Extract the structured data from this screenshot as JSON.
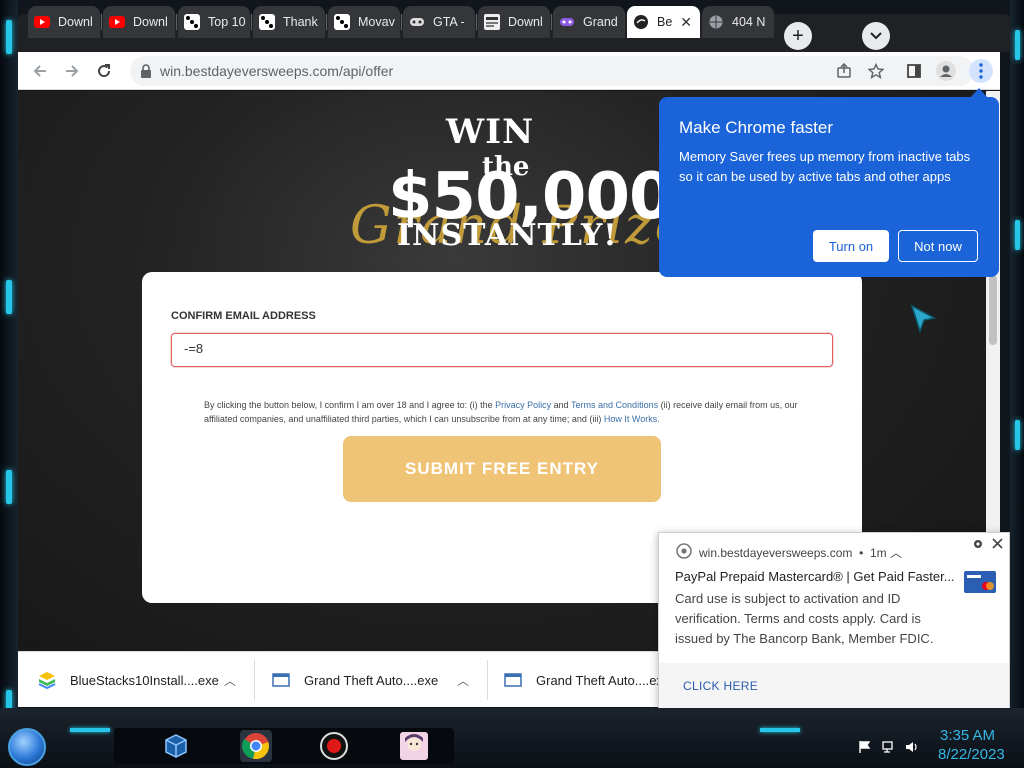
{
  "browser": {
    "tabs": [
      {
        "label": "Downl",
        "favicon": "youtube-icon"
      },
      {
        "label": "Downl",
        "favicon": "youtube-icon"
      },
      {
        "label": "Top 10",
        "favicon": "dice-icon"
      },
      {
        "label": "Thank",
        "favicon": "dice-icon"
      },
      {
        "label": "Movav",
        "favicon": "dice-icon"
      },
      {
        "label": "GTA -",
        "favicon": "gamepad-icon"
      },
      {
        "label": "Downl",
        "favicon": "download-site-icon"
      },
      {
        "label": "Grand",
        "favicon": "purple-gamepad-icon"
      },
      {
        "label": "Be",
        "favicon": "site-icon",
        "active": true
      },
      {
        "label": "404 N",
        "favicon": "globe-icon"
      }
    ],
    "address": "win.bestdayeversweeps.com/api/offer"
  },
  "page": {
    "hero": {
      "line1": "WIN",
      "line2": "the",
      "amount": "$50,000",
      "script": "Grand Prize",
      "line4": "INSTANTLY!"
    },
    "form": {
      "label": "CONFIRM EMAIL ADDRESS",
      "email_value": "-=8",
      "legal_prefix": "By clicking the button below, I confirm I am over 18 and I agree to: (i) the ",
      "privacy_link": "Privacy Policy",
      "and": " and ",
      "terms_link": "Terms and Conditions",
      "legal_mid": " (ii) receive daily email from us, our affiliated companies, and unaffiliated third parties, which I can unsubscribe from at any time; and (iii) ",
      "how_link": "How It Works.",
      "submit": "SUBMIT FREE ENTRY"
    }
  },
  "popup": {
    "title": "Make Chrome faster",
    "body": "Memory Saver frees up memory from inactive tabs so it can be used by active tabs and other apps",
    "turn_on": "Turn on",
    "not_now": "Not now"
  },
  "downloads": [
    {
      "name": "BlueStacks10Install....exe"
    },
    {
      "name": "Grand Theft Auto....exe"
    },
    {
      "name": "Grand Theft Auto....exe"
    }
  ],
  "notification": {
    "site": "win.bestdayeversweeps.com",
    "age": "1m",
    "title": "PayPal Prepaid Mastercard® | Get Paid Faster...",
    "body": "Card use is subject to activation and ID verification. Terms and costs apply. Card is issued by The Bancorp Bank, Member FDIC.",
    "action": "CLICK HERE"
  },
  "taskbar": {
    "time": "3:35 AM",
    "date": "8/22/2023"
  },
  "colors": {
    "accent": "#1a63d8",
    "submit": "#f0c477",
    "gold": "#c9a13a",
    "neon": "#26c6e8"
  }
}
